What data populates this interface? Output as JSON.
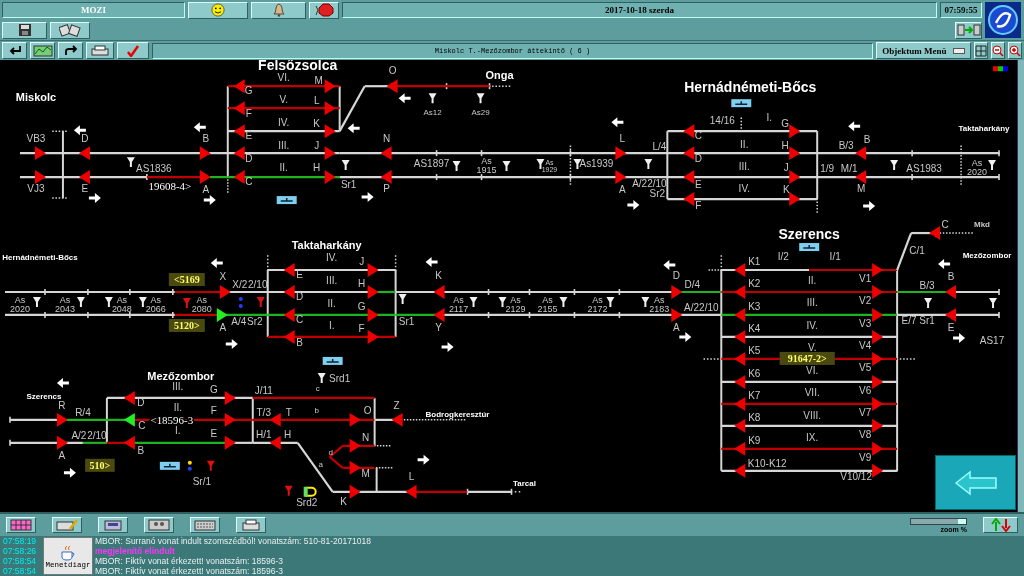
{
  "header": {
    "app_label": "MOZI",
    "date": "2017-10-18  szerda",
    "time": "07:59:55",
    "view_title": "Miskolc T.-Mezőzombor áttekintő ( 6 )",
    "object_menu": "Objektum Menü"
  },
  "diagram": {
    "labels": [
      {
        "text": "Felsőzsolca",
        "kind": "station"
      },
      {
        "text": "Miskolc",
        "kind": "place"
      },
      {
        "text": "Onga",
        "kind": "place"
      },
      {
        "text": "Hernádnémeti-Bőcs",
        "kind": "station"
      },
      {
        "text": "Taktaharkány",
        "kind": "place_small"
      },
      {
        "text": "VI.",
        "kind": "track"
      },
      {
        "text": "V.",
        "kind": "track"
      },
      {
        "text": "IV.",
        "kind": "track"
      },
      {
        "text": "III.",
        "kind": "track"
      },
      {
        "text": "AS1836",
        "kind": "track"
      },
      {
        "text": "II.",
        "kind": "track"
      },
      {
        "text": "19608-4>",
        "kind": "train_plain"
      },
      {
        "text": "Sr1",
        "kind": "track"
      },
      {
        "text": "As12",
        "kind": "small"
      },
      {
        "text": "As29",
        "kind": "small"
      },
      {
        "text": "AS1897",
        "kind": "track"
      },
      {
        "text": "As 1915",
        "kind": "km"
      },
      {
        "text": "As 1929",
        "kind": "km_small"
      },
      {
        "text": "As1939",
        "kind": "track"
      },
      {
        "text": "L/4",
        "kind": "track"
      },
      {
        "text": "A/22/10",
        "kind": "track"
      },
      {
        "text": "Sr2",
        "kind": "track"
      },
      {
        "text": "14/16",
        "kind": "track"
      },
      {
        "text": "I.",
        "kind": "track"
      },
      {
        "text": "II.",
        "kind": "track"
      },
      {
        "text": "III.",
        "kind": "track"
      },
      {
        "text": "IV.",
        "kind": "track"
      },
      {
        "text": "B/3",
        "kind": "track"
      },
      {
        "text": "1/9",
        "kind": "track"
      },
      {
        "text": "M/1",
        "kind": "track"
      },
      {
        "text": "AS1983",
        "kind": "track"
      },
      {
        "text": "As 2020",
        "kind": "km"
      },
      {
        "text": "Hernádnémeti-Bőcs",
        "kind": "place_small"
      },
      {
        "text": "Taktaharkány",
        "kind": "place"
      },
      {
        "text": "As 2020",
        "kind": "km"
      },
      {
        "text": "As 2043",
        "kind": "km"
      },
      {
        "text": "As 2048",
        "kind": "km"
      },
      {
        "text": "As 2066",
        "kind": "km"
      },
      {
        "text": "As 2080",
        "kind": "km"
      },
      {
        "text": "<5169",
        "kind": "train"
      },
      {
        "text": "5120>",
        "kind": "train"
      },
      {
        "text": "X/2",
        "kind": "track"
      },
      {
        "text": "2/10",
        "kind": "track"
      },
      {
        "text": "A/4",
        "kind": "track"
      },
      {
        "text": "Sr2",
        "kind": "track"
      },
      {
        "text": "IV.",
        "kind": "track"
      },
      {
        "text": "III.",
        "kind": "track"
      },
      {
        "text": "II.",
        "kind": "track"
      },
      {
        "text": "I.",
        "kind": "track"
      },
      {
        "text": "Sr1",
        "kind": "track"
      },
      {
        "text": "As 2117",
        "kind": "km"
      },
      {
        "text": "As 2129",
        "kind": "km"
      },
      {
        "text": "As 2155",
        "kind": "km"
      },
      {
        "text": "As 2172",
        "kind": "km"
      },
      {
        "text": "As 2183",
        "kind": "km"
      },
      {
        "text": "D/4",
        "kind": "track"
      },
      {
        "text": "A/22/10",
        "kind": "track"
      },
      {
        "text": "Szerencs",
        "kind": "station"
      },
      {
        "text": "I/2",
        "kind": "track"
      },
      {
        "text": "I/1",
        "kind": "track"
      },
      {
        "text": "II.",
        "kind": "track"
      },
      {
        "text": "III.",
        "kind": "track"
      },
      {
        "text": "IV.",
        "kind": "track"
      },
      {
        "text": "V.",
        "kind": "track"
      },
      {
        "text": "91647-2>",
        "kind": "train"
      },
      {
        "text": "VI.",
        "kind": "track"
      },
      {
        "text": "VII.",
        "kind": "track"
      },
      {
        "text": "VIII.",
        "kind": "track"
      },
      {
        "text": "IX.",
        "kind": "track"
      },
      {
        "text": "C/1",
        "kind": "track"
      },
      {
        "text": "Mkd",
        "kind": "tiny"
      },
      {
        "text": "Mezőzombor",
        "kind": "place_small"
      },
      {
        "text": "B/3",
        "kind": "track"
      },
      {
        "text": "E/7",
        "kind": "track"
      },
      {
        "text": "Sr1",
        "kind": "track"
      },
      {
        "text": "AS17",
        "kind": "track"
      },
      {
        "text": "Mezőzombor",
        "kind": "place"
      },
      {
        "text": "Szerencs",
        "kind": "place_small"
      },
      {
        "text": "R/4",
        "kind": "track"
      },
      {
        "text": "A/2",
        "kind": "track"
      },
      {
        "text": "2/10",
        "kind": "track"
      },
      {
        "text": "III.",
        "kind": "track"
      },
      {
        "text": "II.",
        "kind": "track"
      },
      {
        "text": "<18596-3",
        "kind": "train_plain"
      },
      {
        "text": "I.",
        "kind": "track"
      },
      {
        "text": "J/11",
        "kind": "track"
      },
      {
        "text": "T/3",
        "kind": "track"
      },
      {
        "text": "H/1",
        "kind": "track"
      },
      {
        "text": "c",
        "kind": "small"
      },
      {
        "text": "b",
        "kind": "small"
      },
      {
        "text": "Srd1",
        "kind": "track"
      },
      {
        "text": "a",
        "kind": "small"
      },
      {
        "text": "d",
        "kind": "small"
      },
      {
        "text": "Bodrogkeresztúr",
        "kind": "place_small"
      },
      {
        "text": "Tarcal",
        "kind": "place_small"
      },
      {
        "text": "510>",
        "kind": "train"
      },
      {
        "text": "Sr/1",
        "kind": "track"
      },
      {
        "text": "Srd2",
        "kind": "track"
      }
    ],
    "signals": [
      {
        "label": "VB3",
        "color": "#ee0000"
      },
      {
        "label": "VJ3",
        "color": "#ee0000"
      },
      {
        "label": "D",
        "color": "#ee0000"
      },
      {
        "label": "E",
        "color": "#ee0000"
      },
      {
        "label": "B",
        "color": "#ee0000"
      },
      {
        "label": "A",
        "color": "#ee0000"
      },
      {
        "label": "G",
        "color": "#ee0000"
      },
      {
        "label": "F",
        "color": "#ee0000"
      },
      {
        "label": "E",
        "color": "#ee0000"
      },
      {
        "label": "D",
        "color": "#ee0000"
      },
      {
        "label": "C",
        "color": "#ee0000"
      },
      {
        "label": "M",
        "color": "#ee0000"
      },
      {
        "label": "L",
        "color": "#ee0000"
      },
      {
        "label": "K",
        "color": "#ee0000"
      },
      {
        "label": "J",
        "color": "#ee0000"
      },
      {
        "label": "H",
        "color": "#ee0000"
      },
      {
        "label": "O",
        "color": "#ee0000"
      },
      {
        "label": "N",
        "color": "#ee0000"
      },
      {
        "label": "P",
        "color": "#ee0000"
      },
      {
        "label": "L",
        "color": "#ee0000"
      },
      {
        "label": "A",
        "color": "#ee0000"
      },
      {
        "label": "C",
        "color": "#ee0000"
      },
      {
        "label": "D",
        "color": "#ee0000"
      },
      {
        "label": "E",
        "color": "#ee0000"
      },
      {
        "label": "F",
        "color": "#ee0000"
      },
      {
        "label": "G",
        "color": "#ee0000"
      },
      {
        "label": "H",
        "color": "#ee0000"
      },
      {
        "label": "J",
        "color": "#ee0000"
      },
      {
        "label": "K",
        "color": "#ee0000"
      },
      {
        "label": "B",
        "color": "#ee0000"
      },
      {
        "label": "M",
        "color": "#ee0000"
      },
      {
        "label": "X",
        "color": "#ee0000"
      },
      {
        "label": "A",
        "color": "#22ee22"
      },
      {
        "label": "E",
        "color": "#ee0000"
      },
      {
        "label": "D",
        "color": "#ee0000"
      },
      {
        "label": "C",
        "color": "#ee0000"
      },
      {
        "label": "B",
        "color": "#ee0000"
      },
      {
        "label": "J",
        "color": "#ee0000"
      },
      {
        "label": "H",
        "color": "#ee0000"
      },
      {
        "label": "G",
        "color": "#ee0000"
      },
      {
        "label": "F",
        "color": "#ee0000"
      },
      {
        "label": "K",
        "color": "#ee0000"
      },
      {
        "label": "Y",
        "color": "#ee0000"
      },
      {
        "label": "D",
        "color": "#ee0000"
      },
      {
        "label": "A",
        "color": "#ee0000"
      },
      {
        "label": "K1",
        "color": "#ee0000"
      },
      {
        "label": "K2",
        "color": "#ee0000"
      },
      {
        "label": "K3",
        "color": "#ee0000"
      },
      {
        "label": "K4",
        "color": "#ee0000"
      },
      {
        "label": "K5",
        "color": "#ee0000"
      },
      {
        "label": "K6",
        "color": "#ee0000"
      },
      {
        "label": "K7",
        "color": "#ee0000"
      },
      {
        "label": "K8",
        "color": "#ee0000"
      },
      {
        "label": "K9",
        "color": "#ee0000"
      },
      {
        "label": "K10-K12",
        "color": "#ee0000"
      },
      {
        "label": "V1",
        "color": "#ee0000"
      },
      {
        "label": "V2",
        "color": "#ee0000"
      },
      {
        "label": "V3",
        "color": "#ee0000"
      },
      {
        "label": "V4",
        "color": "#ee0000"
      },
      {
        "label": "V5",
        "color": "#ee0000"
      },
      {
        "label": "V6",
        "color": "#ee0000"
      },
      {
        "label": "V7",
        "color": "#ee0000"
      },
      {
        "label": "V8",
        "color": "#ee0000"
      },
      {
        "label": "V9",
        "color": "#ee0000"
      },
      {
        "label": "V10/12",
        "color": "#ee0000"
      },
      {
        "label": "C",
        "color": "#ee0000"
      },
      {
        "label": "B",
        "color": "#ee0000"
      },
      {
        "label": "E",
        "color": "#ee0000"
      },
      {
        "label": "R",
        "color": "#ee0000"
      },
      {
        "label": "A",
        "color": "#ee0000"
      },
      {
        "label": "D",
        "color": "#ee0000"
      },
      {
        "label": "C",
        "color": "#22ee22"
      },
      {
        "label": "B",
        "color": "#ee0000"
      },
      {
        "label": "G",
        "color": "#ee0000"
      },
      {
        "label": "F",
        "color": "#ee0000"
      },
      {
        "label": "E",
        "color": "#ee0000"
      },
      {
        "label": "T",
        "color": "#ee0000"
      },
      {
        "label": "H",
        "color": "#ee0000"
      },
      {
        "label": "O",
        "color": "#ee0000"
      },
      {
        "label": "N",
        "color": "#ee0000"
      },
      {
        "label": "M",
        "color": "#ee0000"
      },
      {
        "label": "K",
        "color": "#ee0000"
      },
      {
        "label": "Z",
        "color": "#ee0000"
      },
      {
        "label": "L",
        "color": "#ee0000"
      }
    ],
    "tracks": [
      {
        "color": "#d6d6d6"
      },
      {
        "color": "#d6d6d6"
      },
      {
        "color": "#c00000"
      },
      {
        "color": "#1fb41f"
      },
      {
        "color": "#c00000"
      },
      {
        "color": "#c00000"
      },
      {
        "color": "#d6d6d6"
      },
      {
        "color": "#d6d6d6"
      },
      {
        "color": "#1fb41f"
      },
      {
        "color": "#d6d6d6"
      },
      {
        "color": "#d6d6d6"
      },
      {
        "color": "#d6d6d6"
      },
      {
        "color": "#d6d6d6"
      },
      {
        "color": "#c00000"
      },
      {
        "color": "#d6d6d6"
      },
      {
        "color": "#d6d6d6"
      },
      {
        "color": "#d6d6d6"
      },
      {
        "color": "#d6d6d6"
      },
      {
        "color": "#d6d6d6"
      },
      {
        "color": "#d6d6d6"
      },
      {
        "color": "#d6d6d6"
      },
      {
        "color": "#d6d6d6"
      },
      {
        "color": "#c00000"
      },
      {
        "color": "#c00000"
      },
      {
        "color": "#d6d6d6"
      },
      {
        "color": "#1fb41f"
      },
      {
        "color": "#d6d6d6"
      },
      {
        "color": "#d6d6d6"
      },
      {
        "color": "#1fb41f"
      },
      {
        "color": "#1fb41f"
      },
      {
        "color": "#c00000"
      },
      {
        "color": "#d6d6d6"
      },
      {
        "color": "#1fb41f"
      },
      {
        "color": "#d6d6d6"
      },
      {
        "color": "#1fb41f"
      },
      {
        "color": "#d6d6d6"
      },
      {
        "color": "#d6d6d6"
      },
      {
        "color": "#c00000"
      },
      {
        "color": "#c00000"
      },
      {
        "color": "#1fb41f"
      },
      {
        "color": "#d6d6d6"
      },
      {
        "color": "#c00000"
      },
      {
        "color": "#d6d6d6"
      },
      {
        "color": "#c00000"
      },
      {
        "color": "#d6d6d6"
      },
      {
        "color": "#c00000"
      },
      {
        "color": "#d6d6d6"
      },
      {
        "color": "#1fb41f"
      },
      {
        "color": "#d6d6d6"
      },
      {
        "color": "#d6d6d6"
      },
      {
        "color": "#d6d6d6"
      },
      {
        "color": "#d6d6d6"
      },
      {
        "color": "#d6d6d6"
      },
      {
        "color": "#1fb41f"
      },
      {
        "color": "#d6d6d6"
      },
      {
        "color": "#1fb41f"
      },
      {
        "color": "#d6d6d6"
      },
      {
        "color": "#1fb41f"
      },
      {
        "color": "#c00000"
      },
      {
        "color": "#c00000"
      },
      {
        "color": "#1fb41f"
      },
      {
        "color": "#d6d6d6"
      },
      {
        "color": "#c00000"
      },
      {
        "color": "#c00000"
      },
      {
        "color": "#d6d6d6"
      },
      {
        "color": "#d6d6d6"
      },
      {
        "color": "#d6d6d6"
      },
      {
        "color": "#d6d6d6"
      },
      {
        "color": "#c00000"
      },
      {
        "color": "#d6d6d6"
      },
      {
        "color": "#c00000"
      },
      {
        "color": "#c00000"
      },
      {
        "color": "#c00000"
      },
      {
        "color": "#c00000"
      }
    ]
  },
  "toolbar": {
    "zoom": {
      "label": "zoom %",
      "level": 0.85
    }
  },
  "log": {
    "app_icon_label": "Menetdiagr",
    "entries": [
      {
        "time": "07:58:19",
        "message": "MBOR: Surranó vonat indult szomszédból! vonatszám: 510-81-20171018",
        "kind": "info"
      },
      {
        "time": "07:58:26",
        "message": "megjelenítő elindult",
        "kind": "system"
      },
      {
        "time": "07:58:54",
        "message": "MBOR: Fiktív vonat érkezett! vonatszám: 18596-3",
        "kind": "info"
      },
      {
        "time": "07:58:54",
        "message": "MBOR: Fiktív vonat érkezett! vonatszám: 18596-3",
        "kind": "info"
      }
    ]
  }
}
